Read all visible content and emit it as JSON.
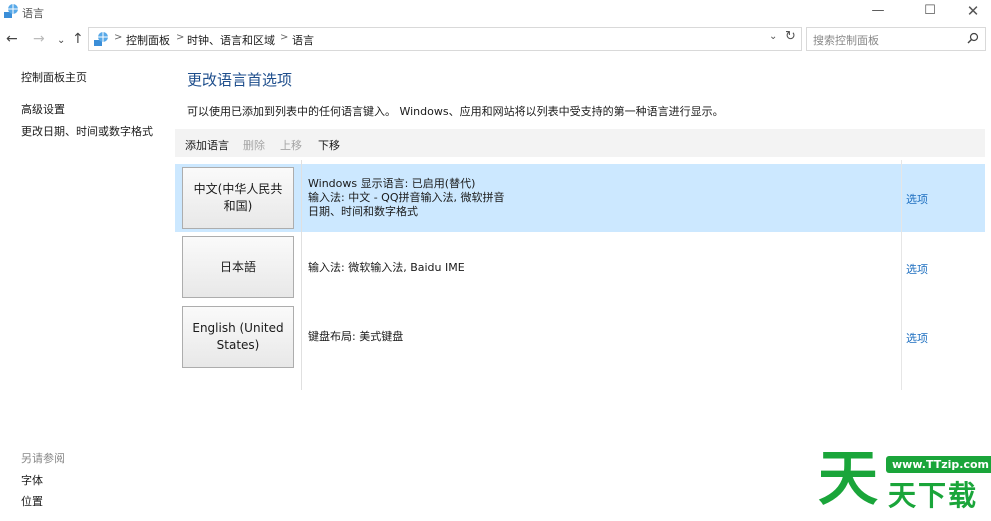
{
  "window": {
    "title": "语言",
    "controls": {
      "minimize": "—",
      "maximize": "☐",
      "close": "✕"
    }
  },
  "navigation": {
    "back": "←",
    "forward": "→",
    "recent": "⌄",
    "up": "↑",
    "breadcrumb": [
      "控制面板",
      "时钟、语言和区域",
      "语言"
    ],
    "separator": ">",
    "dropdown": "⌄",
    "refresh": "↻",
    "search_placeholder": "搜索控制面板"
  },
  "sidebar": {
    "home": "控制面板主页",
    "links": [
      "高级设置",
      "更改日期、时间或数字格式"
    ],
    "see_also_title": "另请参阅",
    "see_also": [
      "字体",
      "位置"
    ]
  },
  "main": {
    "title": "更改语言首选项",
    "description": "可以使用已添加到列表中的任何语言键入。 Windows、应用和网站将以列表中受支持的第一种语言进行显示。",
    "toolbar": {
      "add": "添加语言",
      "delete": "删除",
      "move_up": "上移",
      "move_down": "下移"
    },
    "languages": [
      {
        "name": "中文(中华人民共和国)",
        "details": [
          "Windows 显示语言: 已启用(替代)",
          "输入法: 中文 - QQ拼音输入法, 微软拼音",
          "日期、时间和数字格式"
        ],
        "options": "选项",
        "selected": true
      },
      {
        "name": "日本語",
        "details": [
          "输入法: 微软输入法, Baidu IME"
        ],
        "options": "选项",
        "selected": false
      },
      {
        "name": "English (United States)",
        "details": [
          "键盘布局: 美式键盘"
        ],
        "options": "选项",
        "selected": false
      }
    ]
  },
  "watermark": {
    "url": "www.TTzip.com",
    "big": "天",
    "small": "天下载"
  },
  "colors": {
    "accent": "#1e4e8c",
    "link": "#1e6fc0",
    "selection": "#cce8ff",
    "watermark": "#1aa53a"
  }
}
